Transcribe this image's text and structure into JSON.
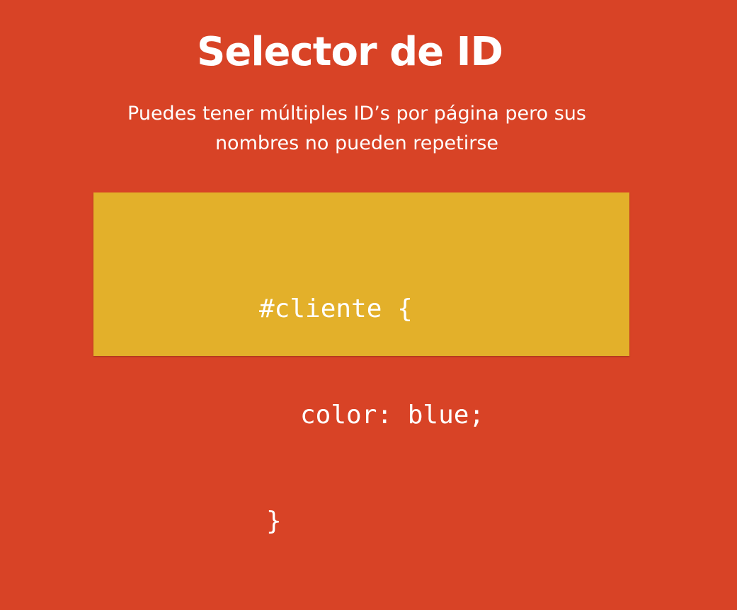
{
  "slide": {
    "title": "Selector de ID",
    "subtitle_lines": [
      "Puedes tener múltiples ID’s por página pero sus",
      "nombres no pueden repetirse"
    ],
    "code_lines": [
      "#cliente {",
      "color: blue;",
      "}"
    ]
  },
  "colors": {
    "background": "#d84326",
    "code_box": "#e3b02a",
    "text": "#ffffff"
  }
}
